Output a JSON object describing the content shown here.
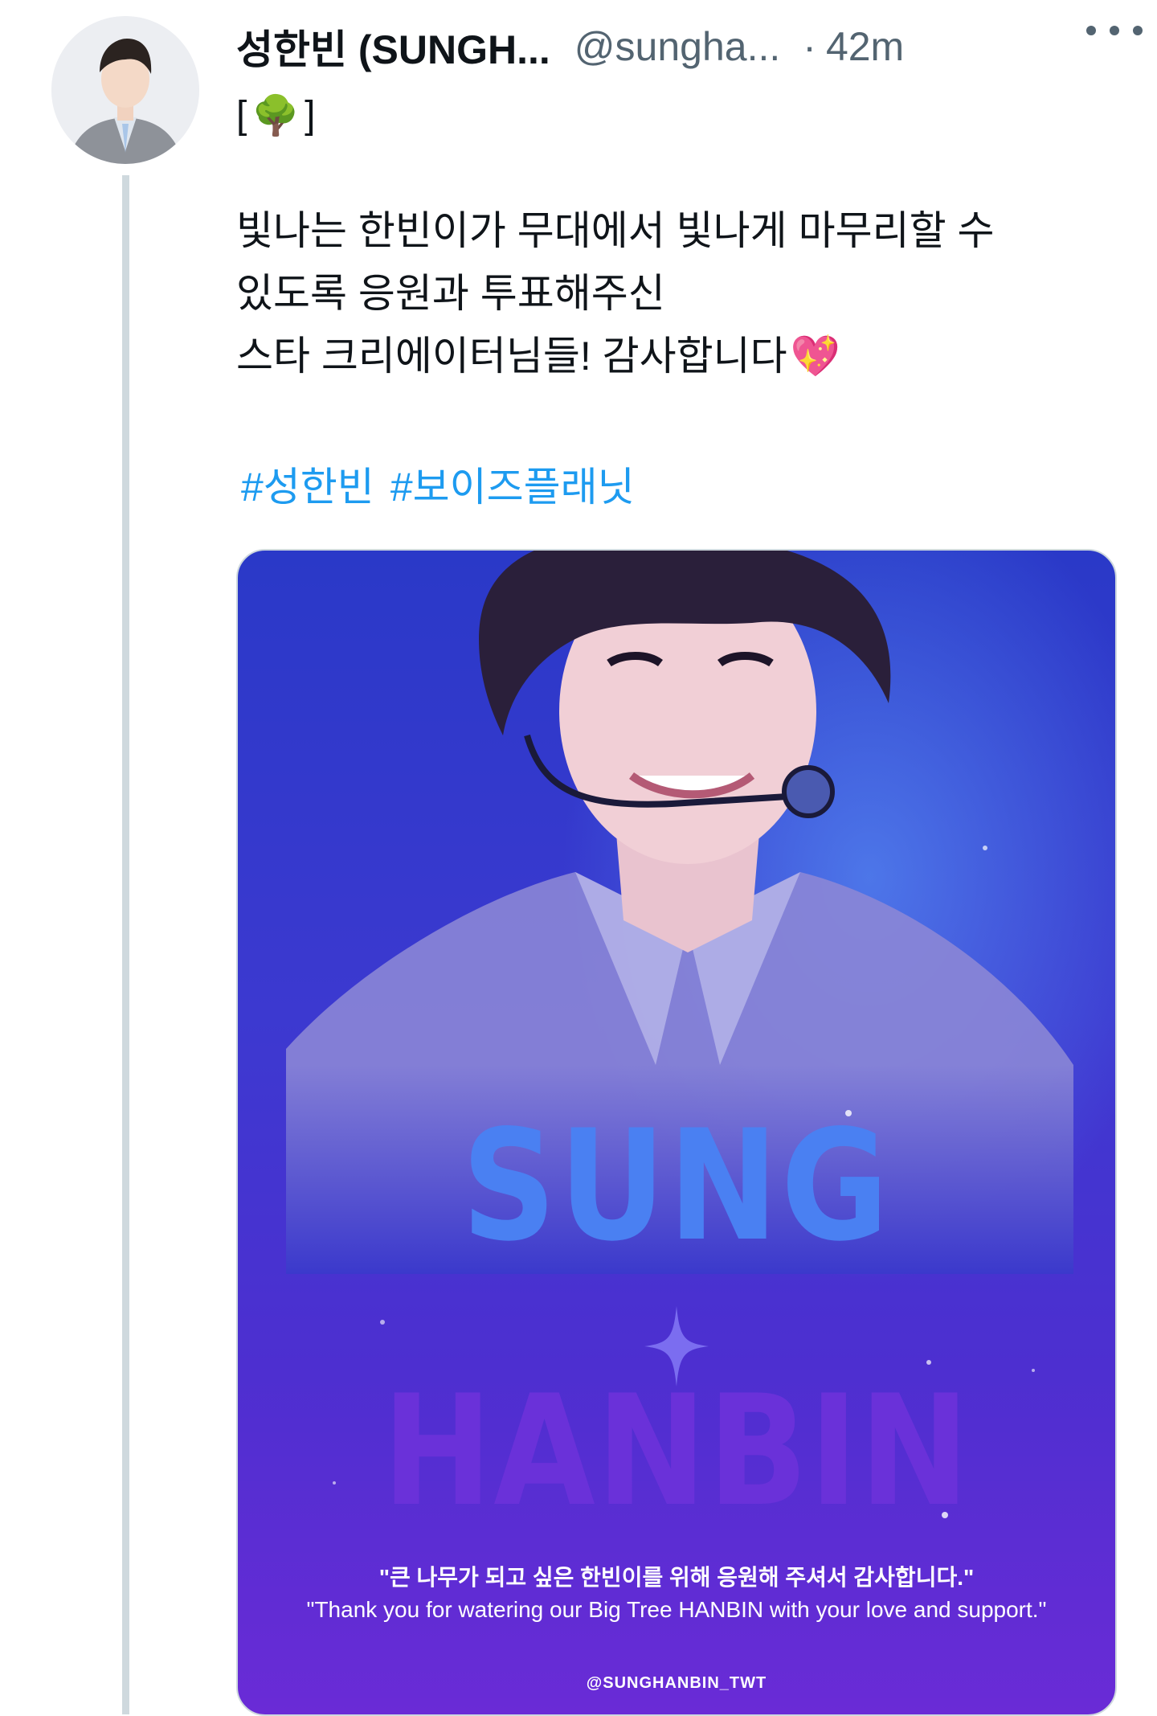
{
  "tweet": {
    "display_name": "성한빈 (SUNGH...",
    "handle": "@sungha...",
    "dot": "·",
    "time": "42m",
    "tree_open": "[",
    "tree_emoji": "🌳",
    "tree_close": "]",
    "body_lines": [
      "빛나는 한빈이가 무대에서 빛나게 마무리할 수",
      "있도록 응원과 투표해주신",
      "스타 크리에이터님들! 감사합니다"
    ],
    "heart_emoji": "💖",
    "hashtags": [
      "#성한빈",
      "#보이즈플래닛"
    ]
  },
  "media": {
    "title_top": "SUNG",
    "title_bottom": "HANBIN",
    "quote_ko": "\"큰 나무가 되고 싶은 한빈이를 위해 응원해 주셔서 감사합니다.\"",
    "quote_en": "\"Thank you for watering our Big Tree HANBIN with your love and support.\"",
    "credit": "@SUNGHANBIN_TWT"
  },
  "colors": {
    "text": "#0f1419",
    "secondary": "#536471",
    "link": "#1d9bf0",
    "poster_blue": "#2a39c8",
    "poster_purple": "#6a2bd6"
  },
  "icons": [
    "more-icon",
    "tree-emoji",
    "heart-emoji",
    "sparkle-icon"
  ]
}
